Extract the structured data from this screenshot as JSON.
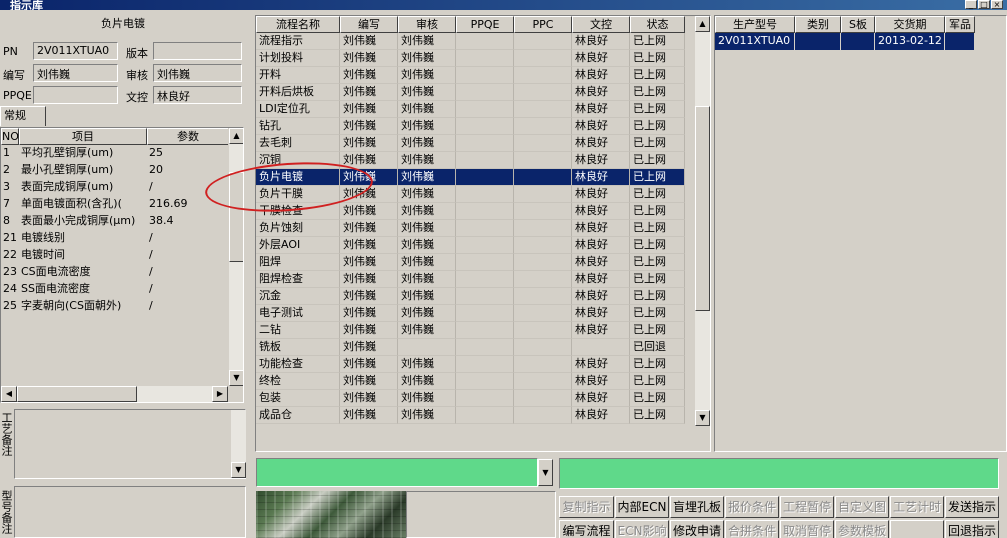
{
  "window": {
    "title": "指示库"
  },
  "left": {
    "title": "负片电镀",
    "fields": {
      "pn_label": "PN",
      "pn_value": "2V011XTUA0",
      "version_label": "版本",
      "version_value": "",
      "writer_label": "编写",
      "writer_value": "刘伟巍",
      "reviewer_label": "审核",
      "reviewer_value": "刘伟巍",
      "ppqe_label": "PPQE",
      "ppqe_value": "",
      "doc_control_label": "文控",
      "doc_control_value": "林良好"
    },
    "tab_label": "常规",
    "params_columns": [
      "NO",
      "项目",
      "参数"
    ],
    "params_rows": [
      {
        "no": "1",
        "item": "平均孔壁铜厚(um)",
        "value": "25"
      },
      {
        "no": "2",
        "item": "最小孔壁铜厚(um)",
        "value": "20"
      },
      {
        "no": "3",
        "item": "表面完成铜厚(um)",
        "value": "/"
      },
      {
        "no": "7",
        "item": "单面电镀面积(含孔)(",
        "value": "216.69"
      },
      {
        "no": "8",
        "item": "表面最小完成铜厚(μm)",
        "value": "38.4"
      },
      {
        "no": "21",
        "item": "电镀线别",
        "value": "/"
      },
      {
        "no": "22",
        "item": "电镀时间",
        "value": "/"
      },
      {
        "no": "23",
        "item": "CS面电流密度",
        "value": "/"
      },
      {
        "no": "24",
        "item": "SS面电流密度",
        "value": "/"
      },
      {
        "no": "25",
        "item": "字麦朝向(CS面朝外)",
        "value": "/"
      }
    ],
    "memo1_label": "工艺备注",
    "memo2_label": "型号备注"
  },
  "main_grid": {
    "columns": [
      "流程名称",
      "编写",
      "审核",
      "PPQE",
      "PPC",
      "文控",
      "状态"
    ],
    "selected_index": 8,
    "rows": [
      [
        "流程指示",
        "刘伟巍",
        "刘伟巍",
        "",
        "",
        "林良好",
        "已上网"
      ],
      [
        "计划投料",
        "刘伟巍",
        "刘伟巍",
        "",
        "",
        "林良好",
        "已上网"
      ],
      [
        "开料",
        "刘伟巍",
        "刘伟巍",
        "",
        "",
        "林良好",
        "已上网"
      ],
      [
        "开料后烘板",
        "刘伟巍",
        "刘伟巍",
        "",
        "",
        "林良好",
        "已上网"
      ],
      [
        "LDI定位孔",
        "刘伟巍",
        "刘伟巍",
        "",
        "",
        "林良好",
        "已上网"
      ],
      [
        "钻孔",
        "刘伟巍",
        "刘伟巍",
        "",
        "",
        "林良好",
        "已上网"
      ],
      [
        "去毛刺",
        "刘伟巍",
        "刘伟巍",
        "",
        "",
        "林良好",
        "已上网"
      ],
      [
        "沉铜",
        "刘伟巍",
        "刘伟巍",
        "",
        "",
        "林良好",
        "已上网"
      ],
      [
        "负片电镀",
        "刘伟巍",
        "刘伟巍",
        "",
        "",
        "林良好",
        "已上网"
      ],
      [
        "负片干膜",
        "刘伟巍",
        "刘伟巍",
        "",
        "",
        "林良好",
        "已上网"
      ],
      [
        "干膜检查",
        "刘伟巍",
        "刘伟巍",
        "",
        "",
        "林良好",
        "已上网"
      ],
      [
        "负片蚀刻",
        "刘伟巍",
        "刘伟巍",
        "",
        "",
        "林良好",
        "已上网"
      ],
      [
        "外层AOI",
        "刘伟巍",
        "刘伟巍",
        "",
        "",
        "林良好",
        "已上网"
      ],
      [
        "阻焊",
        "刘伟巍",
        "刘伟巍",
        "",
        "",
        "林良好",
        "已上网"
      ],
      [
        "阻焊检查",
        "刘伟巍",
        "刘伟巍",
        "",
        "",
        "林良好",
        "已上网"
      ],
      [
        "沉金",
        "刘伟巍",
        "刘伟巍",
        "",
        "",
        "林良好",
        "已上网"
      ],
      [
        "电子测试",
        "刘伟巍",
        "刘伟巍",
        "",
        "",
        "林良好",
        "已上网"
      ],
      [
        "二钻",
        "刘伟巍",
        "刘伟巍",
        "",
        "",
        "林良好",
        "已上网"
      ],
      [
        "铣板",
        "刘伟巍",
        "",
        "",
        "",
        "",
        "已回退"
      ],
      [
        "功能检查",
        "刘伟巍",
        "刘伟巍",
        "",
        "",
        "林良好",
        "已上网"
      ],
      [
        "终检",
        "刘伟巍",
        "刘伟巍",
        "",
        "",
        "林良好",
        "已上网"
      ],
      [
        "包装",
        "刘伟巍",
        "刘伟巍",
        "",
        "",
        "林良好",
        "已上网"
      ],
      [
        "成品仓",
        "刘伟巍",
        "刘伟巍",
        "",
        "",
        "林良好",
        "已上网"
      ]
    ]
  },
  "right_grid": {
    "columns": [
      "生产型号",
      "类别",
      "S板",
      "交货期",
      "军品"
    ],
    "rows": [
      [
        "2V011XTUA0",
        "",
        "",
        "2013-02-12",
        ""
      ]
    ]
  },
  "buttons": {
    "row1": [
      "复制指示",
      "内部ECN",
      "盲埋孔板",
      "报价条件",
      "工程暂停",
      "自定义图",
      "工艺计时",
      "发送指示"
    ],
    "row2": [
      "编写流程",
      "ECN影响",
      "修改申请",
      "合拼条件",
      "取消暂停",
      "参数模板",
      "",
      "回退指示"
    ],
    "row1_enabled": [
      false,
      true,
      true,
      false,
      false,
      false,
      false,
      true
    ],
    "row2_enabled": [
      true,
      false,
      true,
      false,
      false,
      false,
      false,
      true
    ]
  },
  "colors": {
    "selection": "#0a246a",
    "green_field": "#5fd98a",
    "annotation": "#d02020"
  }
}
